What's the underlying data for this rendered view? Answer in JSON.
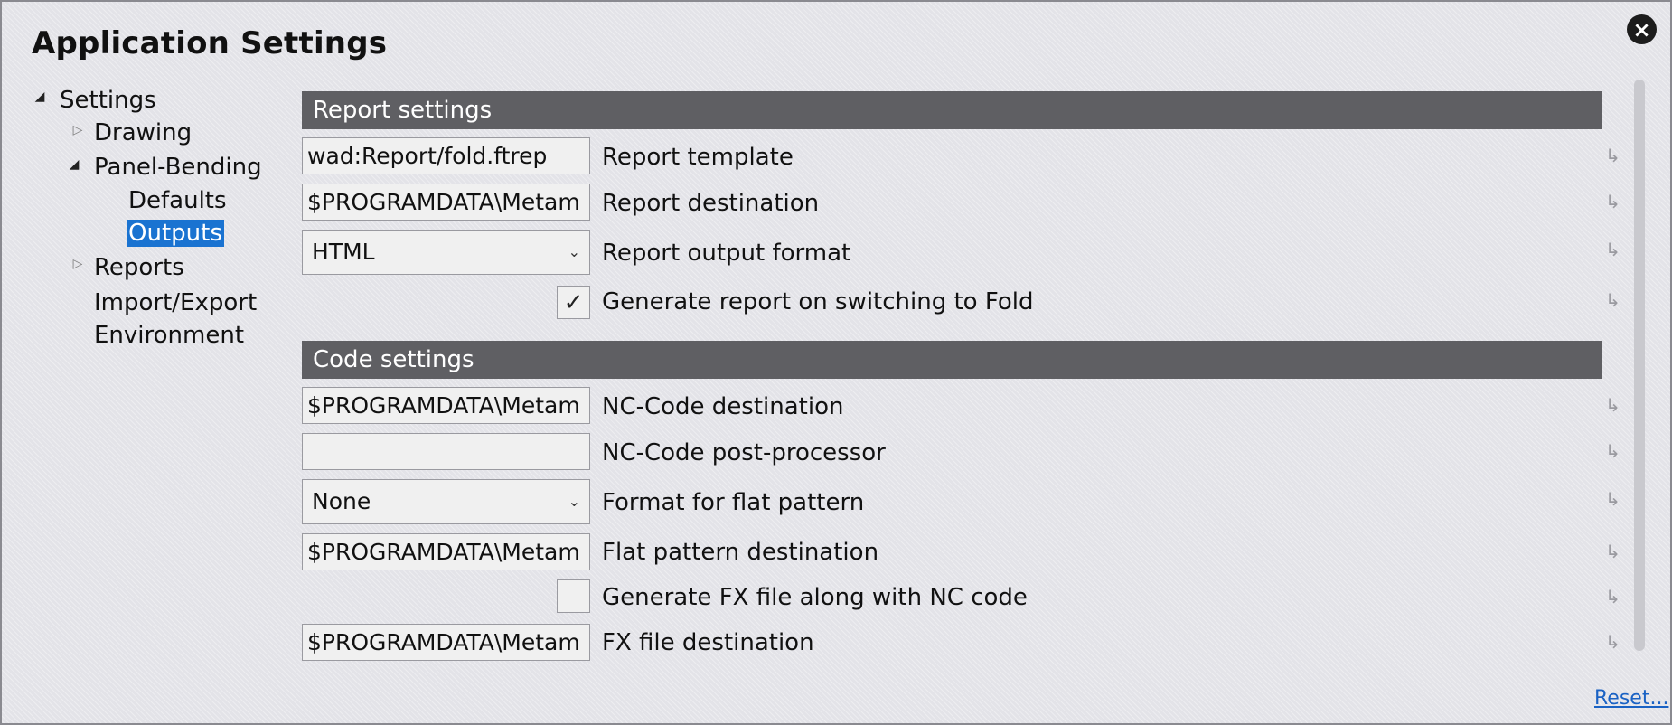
{
  "window": {
    "title": "Application Settings",
    "close_icon": "×",
    "reset_link": "Reset..."
  },
  "tree": {
    "root": {
      "label": "Settings",
      "expanded": true
    },
    "items": [
      {
        "label": "Drawing",
        "expanded": false
      },
      {
        "label": "Panel-Bending",
        "expanded": true
      },
      {
        "label": "Defaults"
      },
      {
        "label": "Outputs",
        "selected": true
      },
      {
        "label": "Reports",
        "expanded": false
      },
      {
        "label": "Import/Export"
      },
      {
        "label": "Environment"
      }
    ]
  },
  "report_settings": {
    "header": "Report settings",
    "template": {
      "value": "wad:Report/fold.ftrep",
      "label": "Report template"
    },
    "destination": {
      "value": "$PROGRAMDATA\\Metam",
      "label": "Report destination"
    },
    "output_format": {
      "value": "HTML",
      "label": "Report output format"
    },
    "generate_on_switch": {
      "checked": true,
      "label": "Generate report on switching to Fold"
    }
  },
  "code_settings": {
    "header": "Code settings",
    "nc_destination": {
      "value": "$PROGRAMDATA\\Metam",
      "label": "NC-Code destination"
    },
    "nc_postprocessor": {
      "value": "",
      "label": "NC-Code post-processor"
    },
    "flat_format": {
      "value": "None",
      "label": "Format for flat pattern"
    },
    "flat_destination": {
      "value": "$PROGRAMDATA\\Metam",
      "label": "Flat pattern destination"
    },
    "generate_fx": {
      "checked": false,
      "label": "Generate FX file along with NC code"
    },
    "fx_destination": {
      "value": "$PROGRAMDATA\\Metam",
      "label": "FX file destination"
    }
  },
  "icons": {
    "tree_open": "◢",
    "tree_closed": "▷",
    "check_mark": "✓",
    "chevron_down": "⌄",
    "reset_to_default": "↳"
  }
}
